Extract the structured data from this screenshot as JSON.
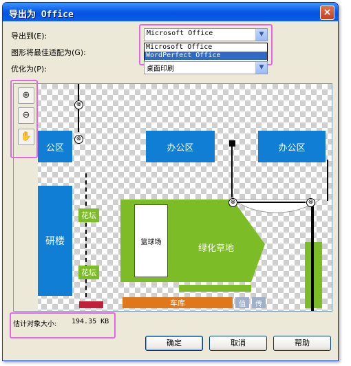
{
  "window": {
    "title": "导出为 Office",
    "close_glyph": "×"
  },
  "form": {
    "export_to_label": "导出到(E):",
    "export_to_value": "Microsoft Office",
    "export_to_options": [
      "Microsoft Office",
      "WordPerfect Office"
    ],
    "fit_label": "图形将最佳适配为(G):",
    "optimize_label": "优化为(P):",
    "optimize_value": "桌面印刷",
    "combo_arrow": "▼"
  },
  "preview": {
    "office_left": "公区",
    "office_center": "办公区",
    "office_right": "办公区",
    "building": "研楼",
    "flower_top": "花坛",
    "flower_bottom": "花坛",
    "basketball": "篮球场",
    "green_area": "绿化草地",
    "garage": "车库",
    "guard_1": "值",
    "guard_2": "传",
    "circle_glyph": "⊗"
  },
  "tools": {
    "zoom_in": "⊕",
    "zoom_out": "⊖",
    "pan": "✋"
  },
  "status": {
    "estimated_size_label": "估计对象大小:",
    "estimated_size_value": "194.35 KB"
  },
  "buttons": {
    "ok": "确定",
    "cancel": "取消",
    "help": "帮助"
  },
  "colors": {
    "accent": "#0f7ed4",
    "green": "#7cbc26",
    "garage": "#e0781a",
    "highlight": "#e466e4"
  }
}
